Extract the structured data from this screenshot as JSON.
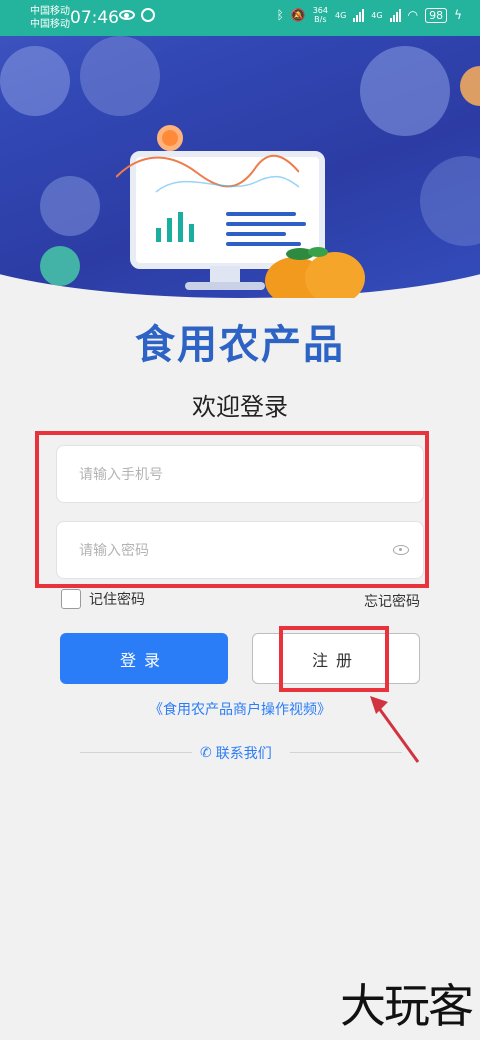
{
  "status_bar": {
    "carrier1": "中国移动",
    "carrier2": "中国移动",
    "time": "07:46",
    "net_speed_value": "364",
    "net_speed_unit": "B/s",
    "net1": "4G",
    "net2": "4G",
    "battery": "98"
  },
  "logo_text": "食用农产品",
  "welcome": "欢迎登录",
  "form": {
    "phone_placeholder": "请输入手机号",
    "password_placeholder": "请输入密码",
    "remember_label": "记住密码",
    "forgot_label": "忘记密码",
    "login_label": "登录",
    "register_label": "注册"
  },
  "video_link": "《食用农产品商户操作视频》",
  "contact": "联系我们",
  "watermark": "大玩客",
  "colors": {
    "accent": "#2b7df7",
    "status_bar": "#24b39c",
    "annotation": "#e8323c"
  }
}
